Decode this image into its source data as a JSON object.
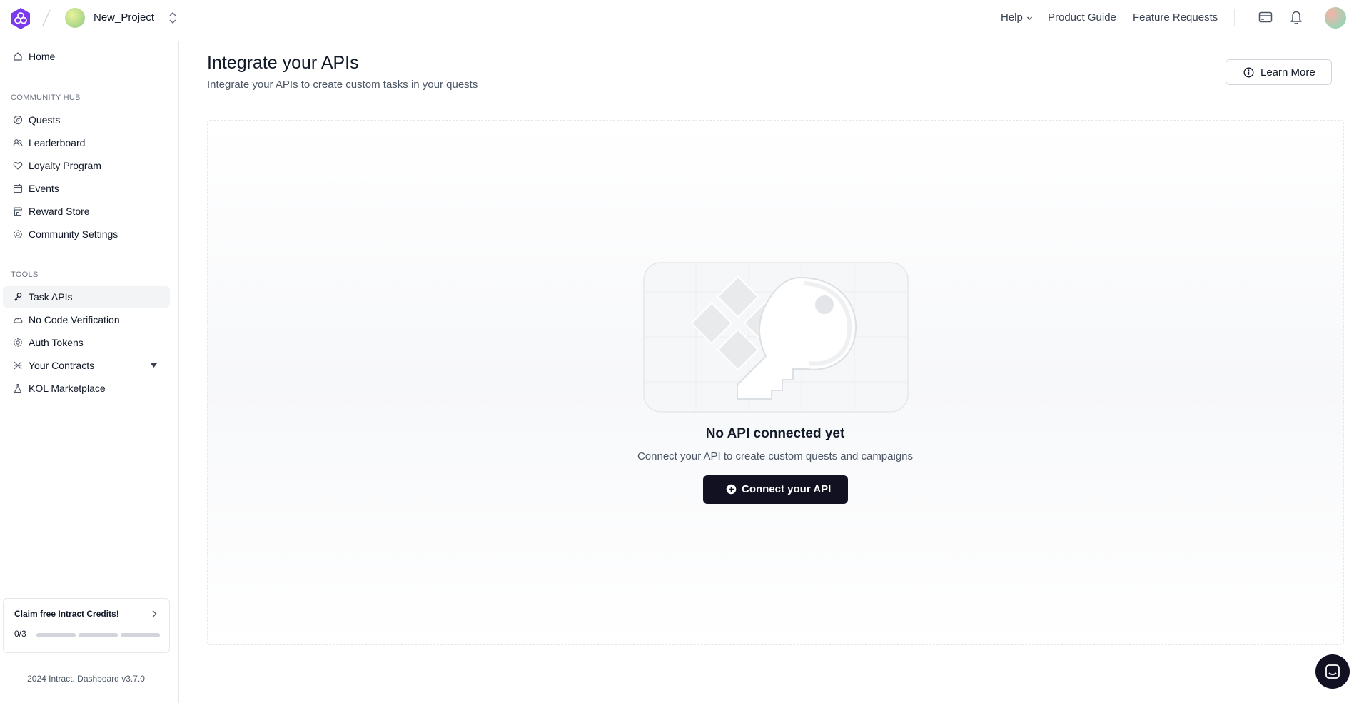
{
  "header": {
    "project_name": "New_Project",
    "nav": {
      "help": "Help",
      "product_guide": "Product Guide",
      "feature_requests": "Feature Requests"
    }
  },
  "sidebar": {
    "home": "Home",
    "community_hub": {
      "section_label": "COMMUNITY HUB",
      "items": [
        "Quests",
        "Leaderboard",
        "Loyalty Program",
        "Events",
        "Reward Store",
        "Community Settings"
      ]
    },
    "tools": {
      "section_label": "TOOLS",
      "items": [
        "Task APIs",
        "No Code Verification",
        "Auth Tokens",
        "Your Contracts",
        "KOL Marketplace"
      ],
      "active": "Task APIs"
    },
    "credits": {
      "title": "Claim free Intract Credits!",
      "count": "0/3",
      "progress": 0
    },
    "footer": "2024 Intract. Dashboard v3.7.0"
  },
  "main": {
    "title": "Integrate your APIs",
    "subtitle": "Integrate your APIs to create custom tasks in your quests",
    "learn_more": "Learn More",
    "empty": {
      "title": "No API connected yet",
      "subtitle": "Connect your API to create custom quests and campaigns",
      "button": "Connect your API"
    }
  },
  "colors": {
    "brand_purple": "#7c3aed",
    "primary_button": "#111122",
    "active_item_bg": "#f3f4f6",
    "border": "#e5e7eb"
  }
}
